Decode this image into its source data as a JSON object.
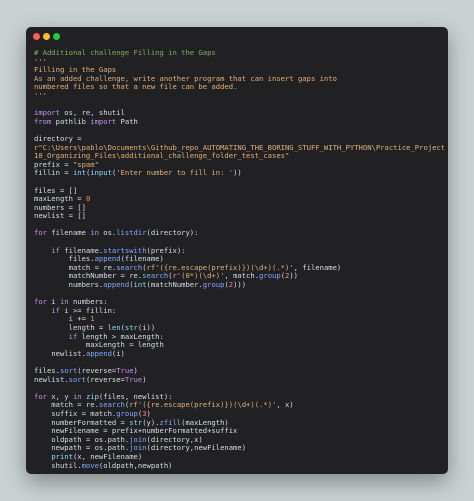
{
  "colors": {
    "background": "#c9d2d1",
    "window": "#212124",
    "close": "#ff5f57",
    "minimize": "#febc2e",
    "maximize": "#28c840",
    "comment": "#7fae63",
    "string": "#e3b079",
    "keyword": "#c990ef",
    "function": "#82aaff",
    "number": "#f78c6c",
    "builtin": "#89ddff",
    "text": "#d8dee9"
  },
  "code": {
    "lines": [
      [
        [
          "comment",
          "# Additional challenge Filling in the Gaps"
        ]
      ],
      [
        [
          "string",
          "'''"
        ]
      ],
      [
        [
          "string",
          "Filling in the Gaps"
        ]
      ],
      [
        [
          "string",
          "As an added challenge, write another program that can insert gaps into"
        ]
      ],
      [
        [
          "string",
          "numbered files so that a new file can be added."
        ]
      ],
      [
        [
          "string",
          "'''"
        ]
      ],
      [],
      [
        [
          "keyword",
          "import"
        ],
        [
          "plain",
          " os, re, shutil"
        ]
      ],
      [
        [
          "keyword",
          "from"
        ],
        [
          "plain",
          " pathlib "
        ],
        [
          "keyword",
          "import"
        ],
        [
          "plain",
          " Path"
        ]
      ],
      [],
      [
        [
          "plain",
          "directory ="
        ]
      ],
      [
        [
          "string",
          "r\"C:\\Users\\pablo\\Documents\\Github_repo_AUTOMATING_THE_BORING_STUFF_WITH_PYTHON\\Practice_Projects\\Chapter_"
        ]
      ],
      [
        [
          "string",
          "10_Organizing_Files\\additional_challenge_folder_test_cases\""
        ]
      ],
      [
        [
          "plain",
          "prefix = "
        ],
        [
          "string",
          "\"spam\""
        ]
      ],
      [
        [
          "plain",
          "fillin = "
        ],
        [
          "builtin",
          "int"
        ],
        [
          "plain",
          "("
        ],
        [
          "builtin",
          "input"
        ],
        [
          "plain",
          "("
        ],
        [
          "string",
          "'Enter number to fill in: '"
        ],
        [
          "plain",
          "))"
        ]
      ],
      [],
      [
        [
          "plain",
          "files = []"
        ]
      ],
      [
        [
          "plain",
          "maxLength = "
        ],
        [
          "num",
          "0"
        ]
      ],
      [
        [
          "plain",
          "numbers = []"
        ]
      ],
      [
        [
          "plain",
          "newlist = []"
        ]
      ],
      [],
      [
        [
          "keyword",
          "for"
        ],
        [
          "plain",
          " filename "
        ],
        [
          "keyword",
          "in"
        ],
        [
          "plain",
          " os."
        ],
        [
          "fn",
          "listdir"
        ],
        [
          "plain",
          "(directory):"
        ]
      ],
      [],
      [
        [
          "plain",
          "    "
        ],
        [
          "keyword",
          "if"
        ],
        [
          "plain",
          " filename."
        ],
        [
          "fn",
          "startswith"
        ],
        [
          "plain",
          "(prefix):"
        ]
      ],
      [
        [
          "plain",
          "        files."
        ],
        [
          "fn",
          "append"
        ],
        [
          "plain",
          "(filename)"
        ]
      ],
      [
        [
          "plain",
          "        match = re."
        ],
        [
          "fn",
          "search"
        ],
        [
          "plain",
          "("
        ],
        [
          "string",
          "rf'({re.escape(prefix)})(\\d+)(.*)'"
        ],
        [
          "plain",
          ", filename)"
        ]
      ],
      [
        [
          "plain",
          "        matchNumber = re."
        ],
        [
          "fn",
          "search"
        ],
        [
          "plain",
          "("
        ],
        [
          "string",
          "r'(0*)(\\d+)'"
        ],
        [
          "plain",
          ", match."
        ],
        [
          "fn",
          "group"
        ],
        [
          "plain",
          "("
        ],
        [
          "num",
          "2"
        ],
        [
          "plain",
          "))"
        ]
      ],
      [
        [
          "plain",
          "        numbers."
        ],
        [
          "fn",
          "append"
        ],
        [
          "plain",
          "("
        ],
        [
          "builtin",
          "int"
        ],
        [
          "plain",
          "(matchNumber."
        ],
        [
          "fn",
          "group"
        ],
        [
          "plain",
          "("
        ],
        [
          "num",
          "2"
        ],
        [
          "plain",
          ")))"
        ]
      ],
      [],
      [
        [
          "keyword",
          "for"
        ],
        [
          "plain",
          " i "
        ],
        [
          "keyword",
          "in"
        ],
        [
          "plain",
          " numbers:"
        ]
      ],
      [
        [
          "plain",
          "    "
        ],
        [
          "keyword",
          "if"
        ],
        [
          "plain",
          " i >= fillin:"
        ]
      ],
      [
        [
          "plain",
          "        i += "
        ],
        [
          "num",
          "1"
        ]
      ],
      [
        [
          "plain",
          "        length = "
        ],
        [
          "builtin",
          "len"
        ],
        [
          "plain",
          "("
        ],
        [
          "builtin",
          "str"
        ],
        [
          "plain",
          "(i))"
        ]
      ],
      [
        [
          "plain",
          "        "
        ],
        [
          "keyword",
          "if"
        ],
        [
          "plain",
          " length > maxLength:"
        ]
      ],
      [
        [
          "plain",
          "            maxLength = length"
        ]
      ],
      [
        [
          "plain",
          "    newlist."
        ],
        [
          "fn",
          "append"
        ],
        [
          "plain",
          "(i)"
        ]
      ],
      [],
      [
        [
          "plain",
          "files."
        ],
        [
          "fn",
          "sort"
        ],
        [
          "plain",
          "(reverse="
        ],
        [
          "keyword",
          "True"
        ],
        [
          "plain",
          ")"
        ]
      ],
      [
        [
          "plain",
          "newlist."
        ],
        [
          "fn",
          "sort"
        ],
        [
          "plain",
          "(reverse="
        ],
        [
          "keyword",
          "True"
        ],
        [
          "plain",
          ")"
        ]
      ],
      [],
      [
        [
          "keyword",
          "for"
        ],
        [
          "plain",
          " x, y "
        ],
        [
          "keyword",
          "in"
        ],
        [
          "plain",
          " "
        ],
        [
          "builtin",
          "zip"
        ],
        [
          "plain",
          "(files, newlist):"
        ]
      ],
      [
        [
          "plain",
          "    match = re."
        ],
        [
          "fn",
          "search"
        ],
        [
          "plain",
          "("
        ],
        [
          "string",
          "rf'({re.escape(prefix)})(\\d+)(.*)'"
        ],
        [
          "plain",
          ", x)"
        ]
      ],
      [
        [
          "plain",
          "    suffix = match."
        ],
        [
          "fn",
          "group"
        ],
        [
          "plain",
          "("
        ],
        [
          "num",
          "3"
        ],
        [
          "plain",
          ")"
        ]
      ],
      [
        [
          "plain",
          "    numberFormatted = "
        ],
        [
          "builtin",
          "str"
        ],
        [
          "plain",
          "(y)."
        ],
        [
          "fn",
          "zfill"
        ],
        [
          "plain",
          "(maxLength)"
        ]
      ],
      [
        [
          "plain",
          "    newFilename = prefix+numberFormatted+suffix"
        ]
      ],
      [
        [
          "plain",
          "    oldpath = os.path."
        ],
        [
          "fn",
          "join"
        ],
        [
          "plain",
          "(directory,x)"
        ]
      ],
      [
        [
          "plain",
          "    newpath = os.path."
        ],
        [
          "fn",
          "join"
        ],
        [
          "plain",
          "(directory,newFilename)"
        ]
      ],
      [
        [
          "plain",
          "    "
        ],
        [
          "builtin",
          "print"
        ],
        [
          "plain",
          "(x, newFilename)"
        ]
      ],
      [
        [
          "plain",
          "    shutil."
        ],
        [
          "fn",
          "move"
        ],
        [
          "plain",
          "(oldpath,newpath)"
        ]
      ]
    ]
  }
}
